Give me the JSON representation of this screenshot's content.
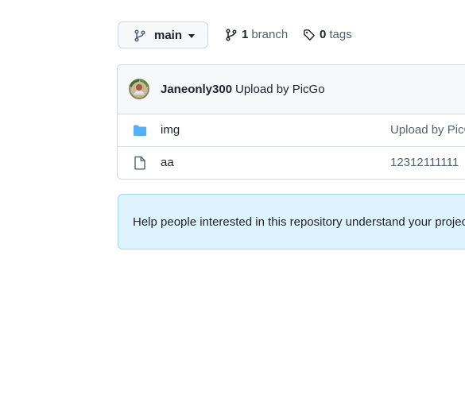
{
  "branch_selector": {
    "icon": "git-branch-icon",
    "name": "main"
  },
  "branches": {
    "icon": "git-branch-icon",
    "count": "1",
    "label": "branch"
  },
  "tags": {
    "icon": "tag-icon",
    "count": "0",
    "label": "tags"
  },
  "latest_commit": {
    "author": "Janeonly300",
    "message": "Upload by PicGo"
  },
  "files": [
    {
      "icon": "folder-icon",
      "name": "img",
      "last_commit": "Upload by PicGo"
    },
    {
      "icon": "file-icon",
      "name": "aa",
      "last_commit": "12312111111"
    }
  ],
  "readme_prompt": {
    "text": "Help people interested in this repository understand your project by adding a README."
  },
  "colors": {
    "folder": "#54aeff",
    "flash_bg": "#ddf4ff",
    "border": "#d0d7de"
  }
}
